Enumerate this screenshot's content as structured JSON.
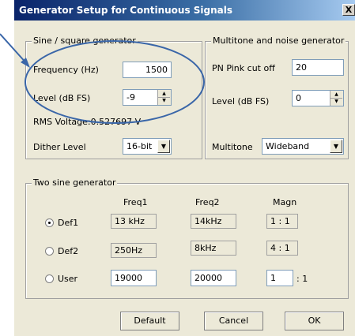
{
  "window": {
    "title": "Generator Setup for Continuous Signals",
    "close_glyph": "X"
  },
  "sine_square": {
    "legend": "Sine / square generator",
    "frequency_label": "Frequency (Hz)",
    "frequency_value": "1500",
    "level_label": "Level (dB FS)",
    "level_value": "-9",
    "rms_text": "RMS Voltage:0.527697 V",
    "dither_label": "Dither Level",
    "dither_value": "16-bit"
  },
  "multitone": {
    "legend": "Multitone and noise generator",
    "pn_label": "PN Pink cut off",
    "pn_value": "20",
    "level_label": "Level (dB FS)",
    "level_value": "0",
    "multitone_label": "Multitone",
    "multitone_value": "Wideband"
  },
  "two_sine": {
    "legend": "Two sine generator",
    "col_freq1": "Freq1",
    "col_freq2": "Freq2",
    "col_magn": "Magn",
    "rows": [
      {
        "label": "Def1",
        "freq1": "13 kHz",
        "freq2": "14kHz",
        "magn": "1 : 1",
        "selected": true
      },
      {
        "label": "Def2",
        "freq1": "250Hz",
        "freq2": "8kHz",
        "magn": "4 : 1",
        "selected": false
      },
      {
        "label": "User",
        "freq1": "19000",
        "freq2": "20000",
        "magn": "1",
        "magn_suffix": ": 1",
        "selected": false
      }
    ]
  },
  "buttons": {
    "default": "Default",
    "cancel": "Cancel",
    "ok": "OK"
  },
  "annotation": {
    "color": "#3a66a8",
    "shape": "ellipse highlight with arrow"
  }
}
